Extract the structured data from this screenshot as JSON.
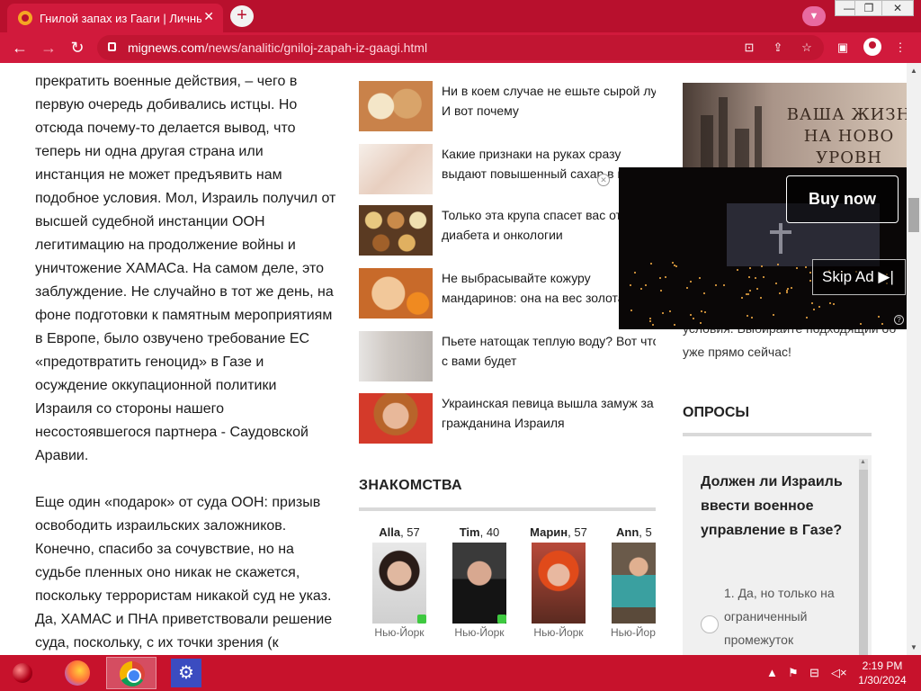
{
  "browser": {
    "tab_title": "Гнилой запах из Гааги | Личный",
    "tab_close": "✕",
    "new_tab": "+",
    "url_domain": "mignews.com",
    "url_path": "/news/analitic/gniloj-zapah-iz-gaagi.html"
  },
  "article": {
    "paragraphs": [
      "прекратить военные действия, – чего в первую очередь добивались истцы. Но отсюда почему-то делается вывод, что теперь ни одна другая страна или инстанция не может предъявить нам подобное условия. Мол, Израиль получил от высшей судебной инстанции ООН легитимацию на продолжение войны и уничтожение ХАМАСа. На самом деле, это заблуждение. Не случайно в тот же день, на фоне подготовки к памятным мероприятиям в Европе, было озвучено требование ЕС «предотвратить геноцид» в Газе и осуждение оккупационной политики Израиля со стороны нашего несостоявшегося партнера - Саудовской Аравии.",
      "Еще один «подарок» от суда ООН: призыв освободить израильских заложников. Конечно, спасибо за сочувствие, но на судьбе пленных оно никак не скажется, поскольку террористам никакой суд не указ. Да, ХАМАС и ПНА приветствовали решение суда, поскольку, с их точки зрения (к"
    ]
  },
  "news": [
    {
      "line1": "Ни в коем случае не ешьте сырой лу",
      "line2": "И вот почему"
    },
    {
      "line1": "Какие признаки на руках сразу",
      "line2": "выдают повышенный сахар в к"
    },
    {
      "line1": "Только эта крупа спасет вас от",
      "line2": "диабета и онкологии"
    },
    {
      "line1": "Не выбрасывайте кожуру",
      "line2": "мандаринов: она на вес золота"
    },
    {
      "line1": "Пьете натощак теплую воду? Вот что",
      "line2": "с вами будет"
    },
    {
      "line1": "Украинская певица вышла замуж за",
      "line2": "гражданина Израиля"
    }
  ],
  "dating": {
    "title": "ЗНАКОМСТВА",
    "profiles": [
      {
        "name": "Alla",
        "age": ", 57",
        "city": "Нью-Йорк"
      },
      {
        "name": "Tim",
        "age": ", 40",
        "city": "Нью-Йорк"
      },
      {
        "name": "Марин",
        "age": ", 57",
        "city": "Нью-Йорк"
      },
      {
        "name": "Ann",
        "age": ", 5",
        "city": "Нью-Йорк"
      }
    ]
  },
  "sidebar": {
    "banner_text": "ВАША ЖИЗН НА НОВО УРОВН",
    "promo_text": "условия. Выбирайте подходящий об уже прямо сейчас!",
    "polls_title": "ОПРОСЫ",
    "poll_question": "Должен ли Израиль ввести военное управление в Газе?",
    "poll_option": "1. Да, но только на ограниченный промежуток"
  },
  "video_ad": {
    "buy_now": "Buy now",
    "skip_ad": "Skip Ad ▶|",
    "help": "?",
    "close": "✕"
  },
  "taskbar": {
    "time": "2:19 PM",
    "date": "1/30/2024"
  },
  "colors": {
    "accent": "#c7122c",
    "chrome_red": "#d11a3c"
  }
}
